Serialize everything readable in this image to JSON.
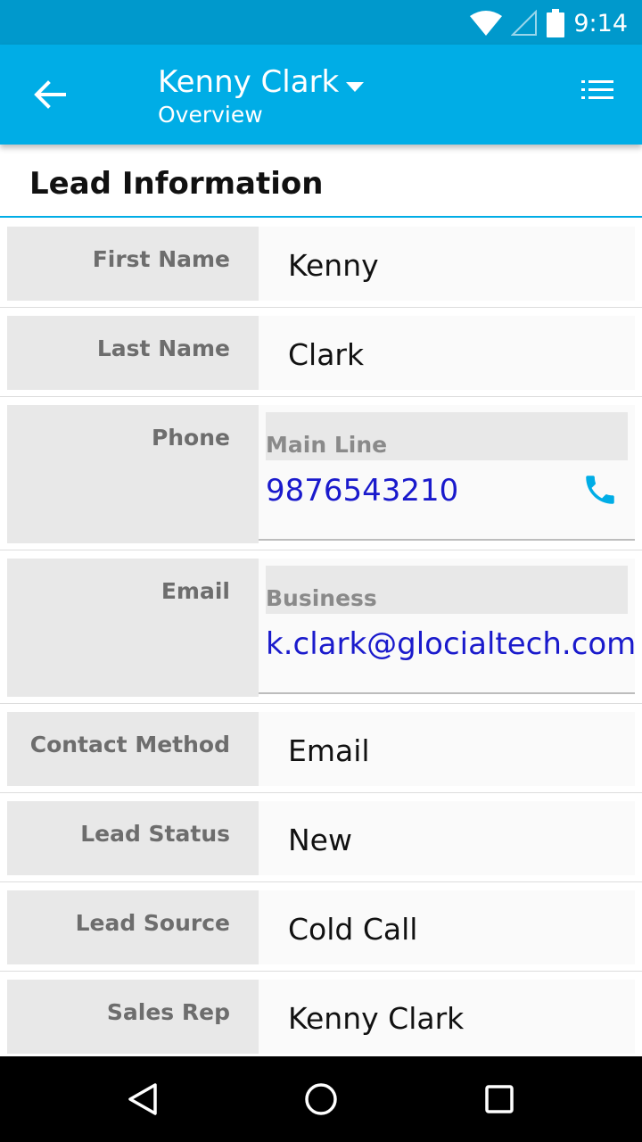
{
  "status_bar": {
    "time": "9:14",
    "icons": [
      "wifi-icon",
      "cellular-signal-icon",
      "battery-icon"
    ]
  },
  "app_bar": {
    "title": "Kenny Clark",
    "subtitle": "Overview",
    "back_icon": "arrow-back-icon",
    "dropdown_icon": "dropdown-triangle-icon",
    "menu_icon": "list-menu-icon"
  },
  "section": {
    "title": "Lead Information"
  },
  "fields": {
    "first_name": {
      "label": "First Name",
      "value": "Kenny"
    },
    "last_name": {
      "label": "Last Name",
      "value": "Clark"
    },
    "phone": {
      "label": "Phone",
      "type": "Main Line",
      "value": "9876543210",
      "icon": "phone-icon"
    },
    "email": {
      "label": "Email",
      "type": "Business",
      "value": "k.clark@glocialtech.com"
    },
    "contact_method": {
      "label": "Contact Method",
      "value": "Email"
    },
    "lead_status": {
      "label": "Lead Status",
      "value": "New"
    },
    "lead_source": {
      "label": "Lead Source",
      "value": "Cold Call"
    },
    "sales_rep": {
      "label": "Sales Rep",
      "value": "Kenny Clark"
    }
  },
  "nav_bar": {
    "icons": [
      "back-triangle-icon",
      "home-circle-icon",
      "recents-square-icon"
    ]
  },
  "colors": {
    "status_bar": "#0099cc",
    "app_bar": "#00ade6",
    "accent": "#00ade6",
    "link": "#1a1acc"
  }
}
